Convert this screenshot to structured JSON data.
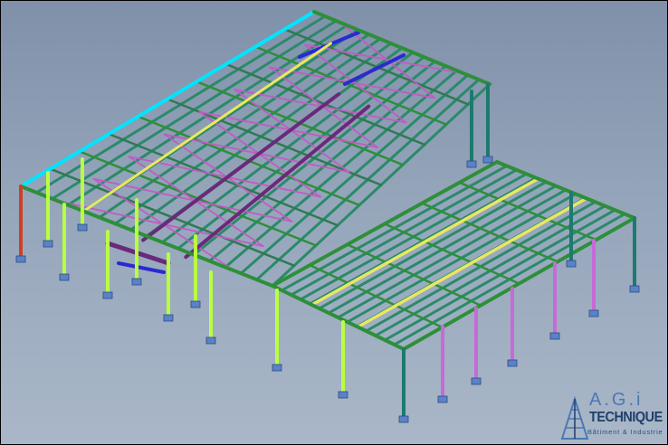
{
  "viewer": {
    "background_top": "#7f90a9",
    "background_bottom": "#a9b7c8"
  },
  "model": {
    "colors": {
      "roof_beam": "#2e8f3a",
      "eave": "#00e5ff",
      "purlin": "#2a8a6a",
      "bracing": "#c05cc4",
      "column_light": "#b8ff40",
      "column_teal": "#1d7a6e",
      "column_purple": "#c66ad8",
      "truss_yellow": "#e8e860",
      "truss_purple": "#6a2a7a",
      "blue_member": "#2a2ad0",
      "red_member": "#d04020",
      "footing": "#5a82c8"
    }
  },
  "logo": {
    "brand": "A.G.i",
    "name": "TECHNIQUE",
    "tagline": "Bâtiment & Industrie",
    "color_primary": "#1f3e6a",
    "color_accent": "#4a78b4"
  }
}
